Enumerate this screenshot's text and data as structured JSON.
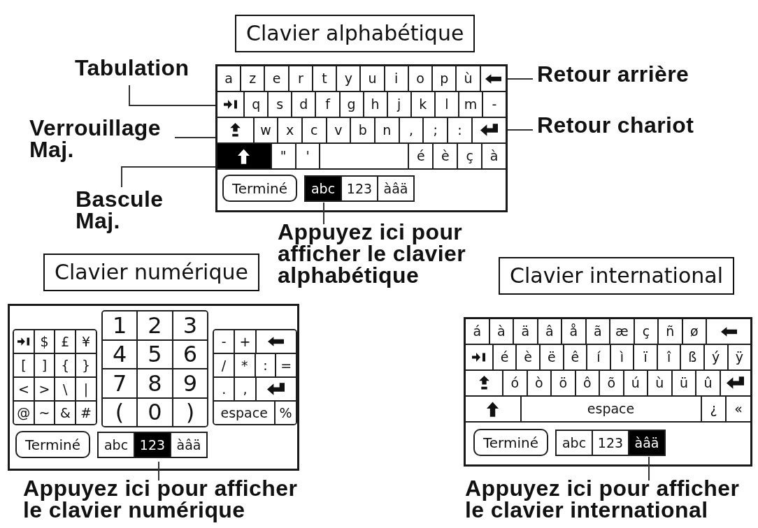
{
  "keyboards": [
    {
      "kind": "alpha",
      "title": "Clavier alphabétique",
      "shift_on": true,
      "rows": [
        {
          "keys": [
            {
              "kind": "char",
              "label": "a"
            },
            {
              "kind": "char",
              "label": "z"
            },
            {
              "kind": "char",
              "label": "e"
            },
            {
              "kind": "char",
              "label": "r"
            },
            {
              "kind": "char",
              "label": "t"
            },
            {
              "kind": "char",
              "label": "y"
            },
            {
              "kind": "char",
              "label": "u"
            },
            {
              "kind": "char",
              "label": "i"
            },
            {
              "kind": "char",
              "label": "o"
            },
            {
              "kind": "char",
              "label": "p"
            },
            {
              "kind": "char",
              "label": "ù"
            },
            {
              "kind": "backspace"
            }
          ]
        },
        {
          "keys": [
            {
              "kind": "tab"
            },
            {
              "kind": "char",
              "label": "q"
            },
            {
              "kind": "char",
              "label": "s"
            },
            {
              "kind": "char",
              "label": "d"
            },
            {
              "kind": "char",
              "label": "f"
            },
            {
              "kind": "char",
              "label": "g"
            },
            {
              "kind": "char",
              "label": "h"
            },
            {
              "kind": "char",
              "label": "j"
            },
            {
              "kind": "char",
              "label": "k"
            },
            {
              "kind": "char",
              "label": "l"
            },
            {
              "kind": "char",
              "label": "m"
            },
            {
              "kind": "char",
              "label": "-"
            }
          ]
        },
        {
          "keys": [
            {
              "kind": "caps"
            },
            {
              "kind": "char",
              "label": "w"
            },
            {
              "kind": "char",
              "label": "x"
            },
            {
              "kind": "char",
              "label": "c"
            },
            {
              "kind": "char",
              "label": "v"
            },
            {
              "kind": "char",
              "label": "b"
            },
            {
              "kind": "char",
              "label": "n"
            },
            {
              "kind": "char",
              "label": ","
            },
            {
              "kind": "char",
              "label": ";"
            },
            {
              "kind": "char",
              "label": ":"
            },
            {
              "kind": "return"
            }
          ]
        },
        {
          "keys": [
            {
              "kind": "shift"
            },
            {
              "kind": "char",
              "label": "\""
            },
            {
              "kind": "char",
              "label": "'"
            },
            {
              "kind": "space"
            },
            {
              "kind": "char",
              "label": "é"
            },
            {
              "kind": "char",
              "label": "è"
            },
            {
              "kind": "char",
              "label": "ç"
            },
            {
              "kind": "char",
              "label": "à"
            }
          ]
        }
      ],
      "done_button": "Terminé",
      "mode_tabs": [
        {
          "label": "abc",
          "selected": true
        },
        {
          "label": "123",
          "selected": false
        },
        {
          "label": "àâä",
          "selected": false
        }
      ],
      "callouts": [
        {
          "lines": [
            "Tabulation"
          ]
        },
        {
          "lines": [
            "Verrouillage",
            "Maj."
          ]
        },
        {
          "lines": [
            "Bascule",
            "Maj."
          ]
        },
        {
          "lines": [
            "Retour arrière"
          ]
        },
        {
          "lines": [
            "Retour chariot"
          ]
        },
        {
          "lines": [
            "Appuyez ici pour",
            "afficher le clavier",
            "alphabétique"
          ]
        }
      ]
    },
    {
      "kind": "numeric",
      "title": "Clavier numérique",
      "blocks": [
        {
          "kind": "symbols",
          "rows": [
            {
              "keys": [
                {
                  "kind": "tab"
                },
                {
                  "kind": "char",
                  "label": "$"
                },
                {
                  "kind": "char",
                  "label": "£"
                },
                {
                  "kind": "char",
                  "label": "¥"
                }
              ]
            },
            {
              "keys": [
                {
                  "kind": "char",
                  "label": "["
                },
                {
                  "kind": "char",
                  "label": "]"
                },
                {
                  "kind": "char",
                  "label": "{"
                },
                {
                  "kind": "char",
                  "label": "}"
                }
              ]
            },
            {
              "keys": [
                {
                  "kind": "char",
                  "label": "<"
                },
                {
                  "kind": "char",
                  "label": ">"
                },
                {
                  "kind": "char",
                  "label": "\\"
                },
                {
                  "kind": "char",
                  "label": "|"
                }
              ]
            },
            {
              "keys": [
                {
                  "kind": "char",
                  "label": "@"
                },
                {
                  "kind": "char",
                  "label": "~"
                },
                {
                  "kind": "char",
                  "label": "&"
                },
                {
                  "kind": "char",
                  "label": "#"
                }
              ]
            }
          ]
        },
        {
          "kind": "digits",
          "rows": [
            {
              "keys": [
                {
                  "kind": "char",
                  "label": "1"
                },
                {
                  "kind": "char",
                  "label": "2"
                },
                {
                  "kind": "char",
                  "label": "3"
                }
              ]
            },
            {
              "keys": [
                {
                  "kind": "char",
                  "label": "4"
                },
                {
                  "kind": "char",
                  "label": "5"
                },
                {
                  "kind": "char",
                  "label": "6"
                }
              ]
            },
            {
              "keys": [
                {
                  "kind": "char",
                  "label": "7"
                },
                {
                  "kind": "char",
                  "label": "8"
                },
                {
                  "kind": "char",
                  "label": "9"
                }
              ]
            },
            {
              "keys": [
                {
                  "kind": "char",
                  "label": "("
                },
                {
                  "kind": "char",
                  "label": "0"
                },
                {
                  "kind": "char",
                  "label": ")"
                }
              ]
            }
          ]
        },
        {
          "kind": "symbols",
          "rows": [
            {
              "keys": [
                {
                  "kind": "char",
                  "label": "-"
                },
                {
                  "kind": "char",
                  "label": "+"
                },
                {
                  "kind": "backspace"
                }
              ]
            },
            {
              "keys": [
                {
                  "kind": "char",
                  "label": "/"
                },
                {
                  "kind": "char",
                  "label": "*"
                },
                {
                  "kind": "char",
                  "label": ":"
                },
                {
                  "kind": "char",
                  "label": "="
                }
              ]
            },
            {
              "keys": [
                {
                  "kind": "char",
                  "label": "."
                },
                {
                  "kind": "char",
                  "label": ","
                },
                {
                  "kind": "return"
                }
              ]
            },
            {
              "keys": [
                {
                  "kind": "space",
                  "label": "espace"
                },
                {
                  "kind": "char",
                  "label": "%"
                }
              ]
            }
          ]
        }
      ],
      "done_button": "Terminé",
      "mode_tabs": [
        {
          "label": "abc",
          "selected": false
        },
        {
          "label": "123",
          "selected": true
        },
        {
          "label": "àâä",
          "selected": false
        }
      ],
      "callouts": [
        {
          "lines": [
            "Appuyez ici pour afficher",
            "le clavier numérique"
          ]
        }
      ]
    },
    {
      "kind": "international",
      "title": "Clavier international",
      "shift_on": false,
      "rows": [
        {
          "keys": [
            {
              "kind": "char",
              "label": "á"
            },
            {
              "kind": "char",
              "label": "à"
            },
            {
              "kind": "char",
              "label": "ä"
            },
            {
              "kind": "char",
              "label": "â"
            },
            {
              "kind": "char",
              "label": "å"
            },
            {
              "kind": "char",
              "label": "ã"
            },
            {
              "kind": "char",
              "label": "æ"
            },
            {
              "kind": "char",
              "label": "ç"
            },
            {
              "kind": "char",
              "label": "ñ"
            },
            {
              "kind": "char",
              "label": "ø"
            },
            {
              "kind": "backspace"
            }
          ]
        },
        {
          "keys": [
            {
              "kind": "tab"
            },
            {
              "kind": "char",
              "label": "é"
            },
            {
              "kind": "char",
              "label": "è"
            },
            {
              "kind": "char",
              "label": "ë"
            },
            {
              "kind": "char",
              "label": "ê"
            },
            {
              "kind": "char",
              "label": "í"
            },
            {
              "kind": "char",
              "label": "ì"
            },
            {
              "kind": "char",
              "label": "ï"
            },
            {
              "kind": "char",
              "label": "î"
            },
            {
              "kind": "char",
              "label": "ß"
            },
            {
              "kind": "char",
              "label": "ý"
            },
            {
              "kind": "char",
              "label": "ÿ"
            }
          ]
        },
        {
          "keys": [
            {
              "kind": "caps"
            },
            {
              "kind": "char",
              "label": "ó"
            },
            {
              "kind": "char",
              "label": "ò"
            },
            {
              "kind": "char",
              "label": "ö"
            },
            {
              "kind": "char",
              "label": "ô"
            },
            {
              "kind": "char",
              "label": "õ"
            },
            {
              "kind": "char",
              "label": "ú"
            },
            {
              "kind": "char",
              "label": "ù"
            },
            {
              "kind": "char",
              "label": "ü"
            },
            {
              "kind": "char",
              "label": "û"
            },
            {
              "kind": "return"
            }
          ]
        },
        {
          "keys": [
            {
              "kind": "shift"
            },
            {
              "kind": "space",
              "label": "espace"
            },
            {
              "kind": "char",
              "label": "¿"
            },
            {
              "kind": "char",
              "label": "«"
            }
          ]
        }
      ],
      "done_button": "Terminé",
      "mode_tabs": [
        {
          "label": "abc",
          "selected": false
        },
        {
          "label": "123",
          "selected": false
        },
        {
          "label": "àâä",
          "selected": true
        }
      ],
      "callouts": [
        {
          "lines": [
            "Appuyez ici pour afficher",
            "le clavier international"
          ]
        }
      ]
    }
  ]
}
